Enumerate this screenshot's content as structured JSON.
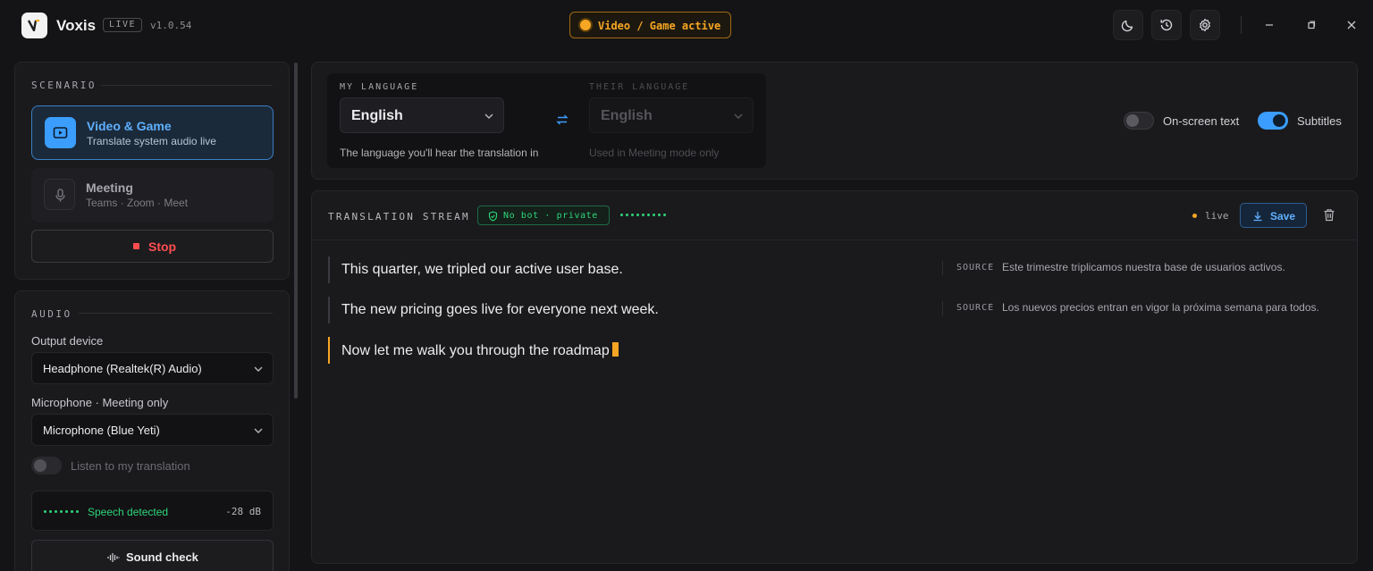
{
  "app": {
    "name": "Voxis",
    "badge": "LIVE",
    "version": "v1.0.54"
  },
  "status_pill": "Video / Game active",
  "colors": {
    "accent_blue": "#3b9eff",
    "accent_amber": "#f6a623",
    "success_green": "#2ed47a",
    "danger_red": "#ff4d4f"
  },
  "toolbar_icons": [
    "moon-icon",
    "history-icon",
    "settings-icon"
  ],
  "window_controls": [
    "minimize-icon",
    "restore-icon",
    "close-icon"
  ],
  "sidebar": {
    "scenario": {
      "label": "SCENARIO",
      "cards": [
        {
          "title": "Video & Game",
          "subtitle": "Translate system audio live",
          "icon": "video-icon",
          "selected": true
        },
        {
          "title": "Meeting",
          "subtitle": "Teams · Zoom · Meet",
          "icon": "microphone-icon",
          "selected": false
        }
      ],
      "stop_label": "Stop"
    },
    "audio": {
      "label": "AUDIO",
      "output_label": "Output device",
      "output_value": "Headphone (Realtek(R) Audio)",
      "mic_label": "Microphone · Meeting only",
      "mic_value": "Microphone (Blue Yeti)",
      "listen_label": "Listen to my translation",
      "listen_on": false,
      "speech_status": "Speech detected",
      "level": "-28 dB",
      "sound_check_label": "Sound check"
    }
  },
  "languages": {
    "mine": {
      "label": "MY LANGUAGE",
      "value": "English",
      "hint": "The language you'll hear the translation in"
    },
    "theirs": {
      "label": "THEIR LANGUAGE",
      "value": "English",
      "hint": "Used in Meeting mode only",
      "disabled": true
    }
  },
  "toggles": {
    "onscreen": {
      "label": "On-screen text",
      "on": false
    },
    "subtitles": {
      "label": "Subtitles",
      "on": true
    }
  },
  "stream": {
    "title": "TRANSLATION STREAM",
    "privacy_badge": "No bot · private",
    "live_label": "live",
    "save_label": "Save",
    "source_key": "SOURCE",
    "lines": [
      {
        "text": "This quarter, we tripled our active user base.",
        "source": "Este trimestre triplicamos nuestra base de usuarios activos."
      },
      {
        "text": "The new pricing goes live for everyone next week.",
        "source": "Los nuevos precios entran en vigor la próxima semana para todos."
      },
      {
        "text": "Now let me walk you through the roadmap",
        "source": ""
      }
    ]
  }
}
